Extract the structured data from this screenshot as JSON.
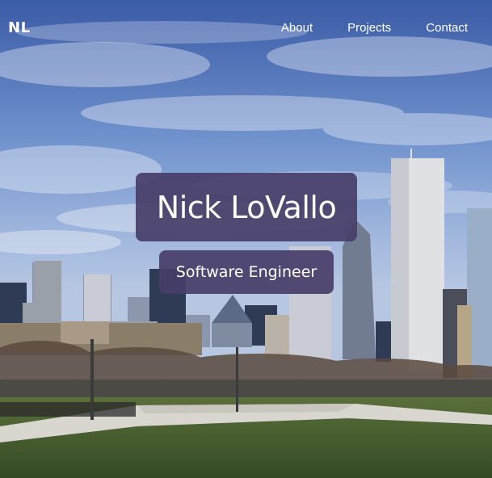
{
  "site": {
    "logo": "NL",
    "nav": [
      "About",
      "Projects",
      "Contact"
    ]
  },
  "hero": {
    "name": "Nick LoVallo",
    "title": "Software Engineer",
    "background_scene": "city-skyline-photo"
  },
  "colors": {
    "sky_top": "#3d5fa8",
    "sky_mid": "#7a9ad0",
    "card_bg": "#463e68",
    "grass": "#3f5a2c",
    "text": "#ffffff"
  }
}
